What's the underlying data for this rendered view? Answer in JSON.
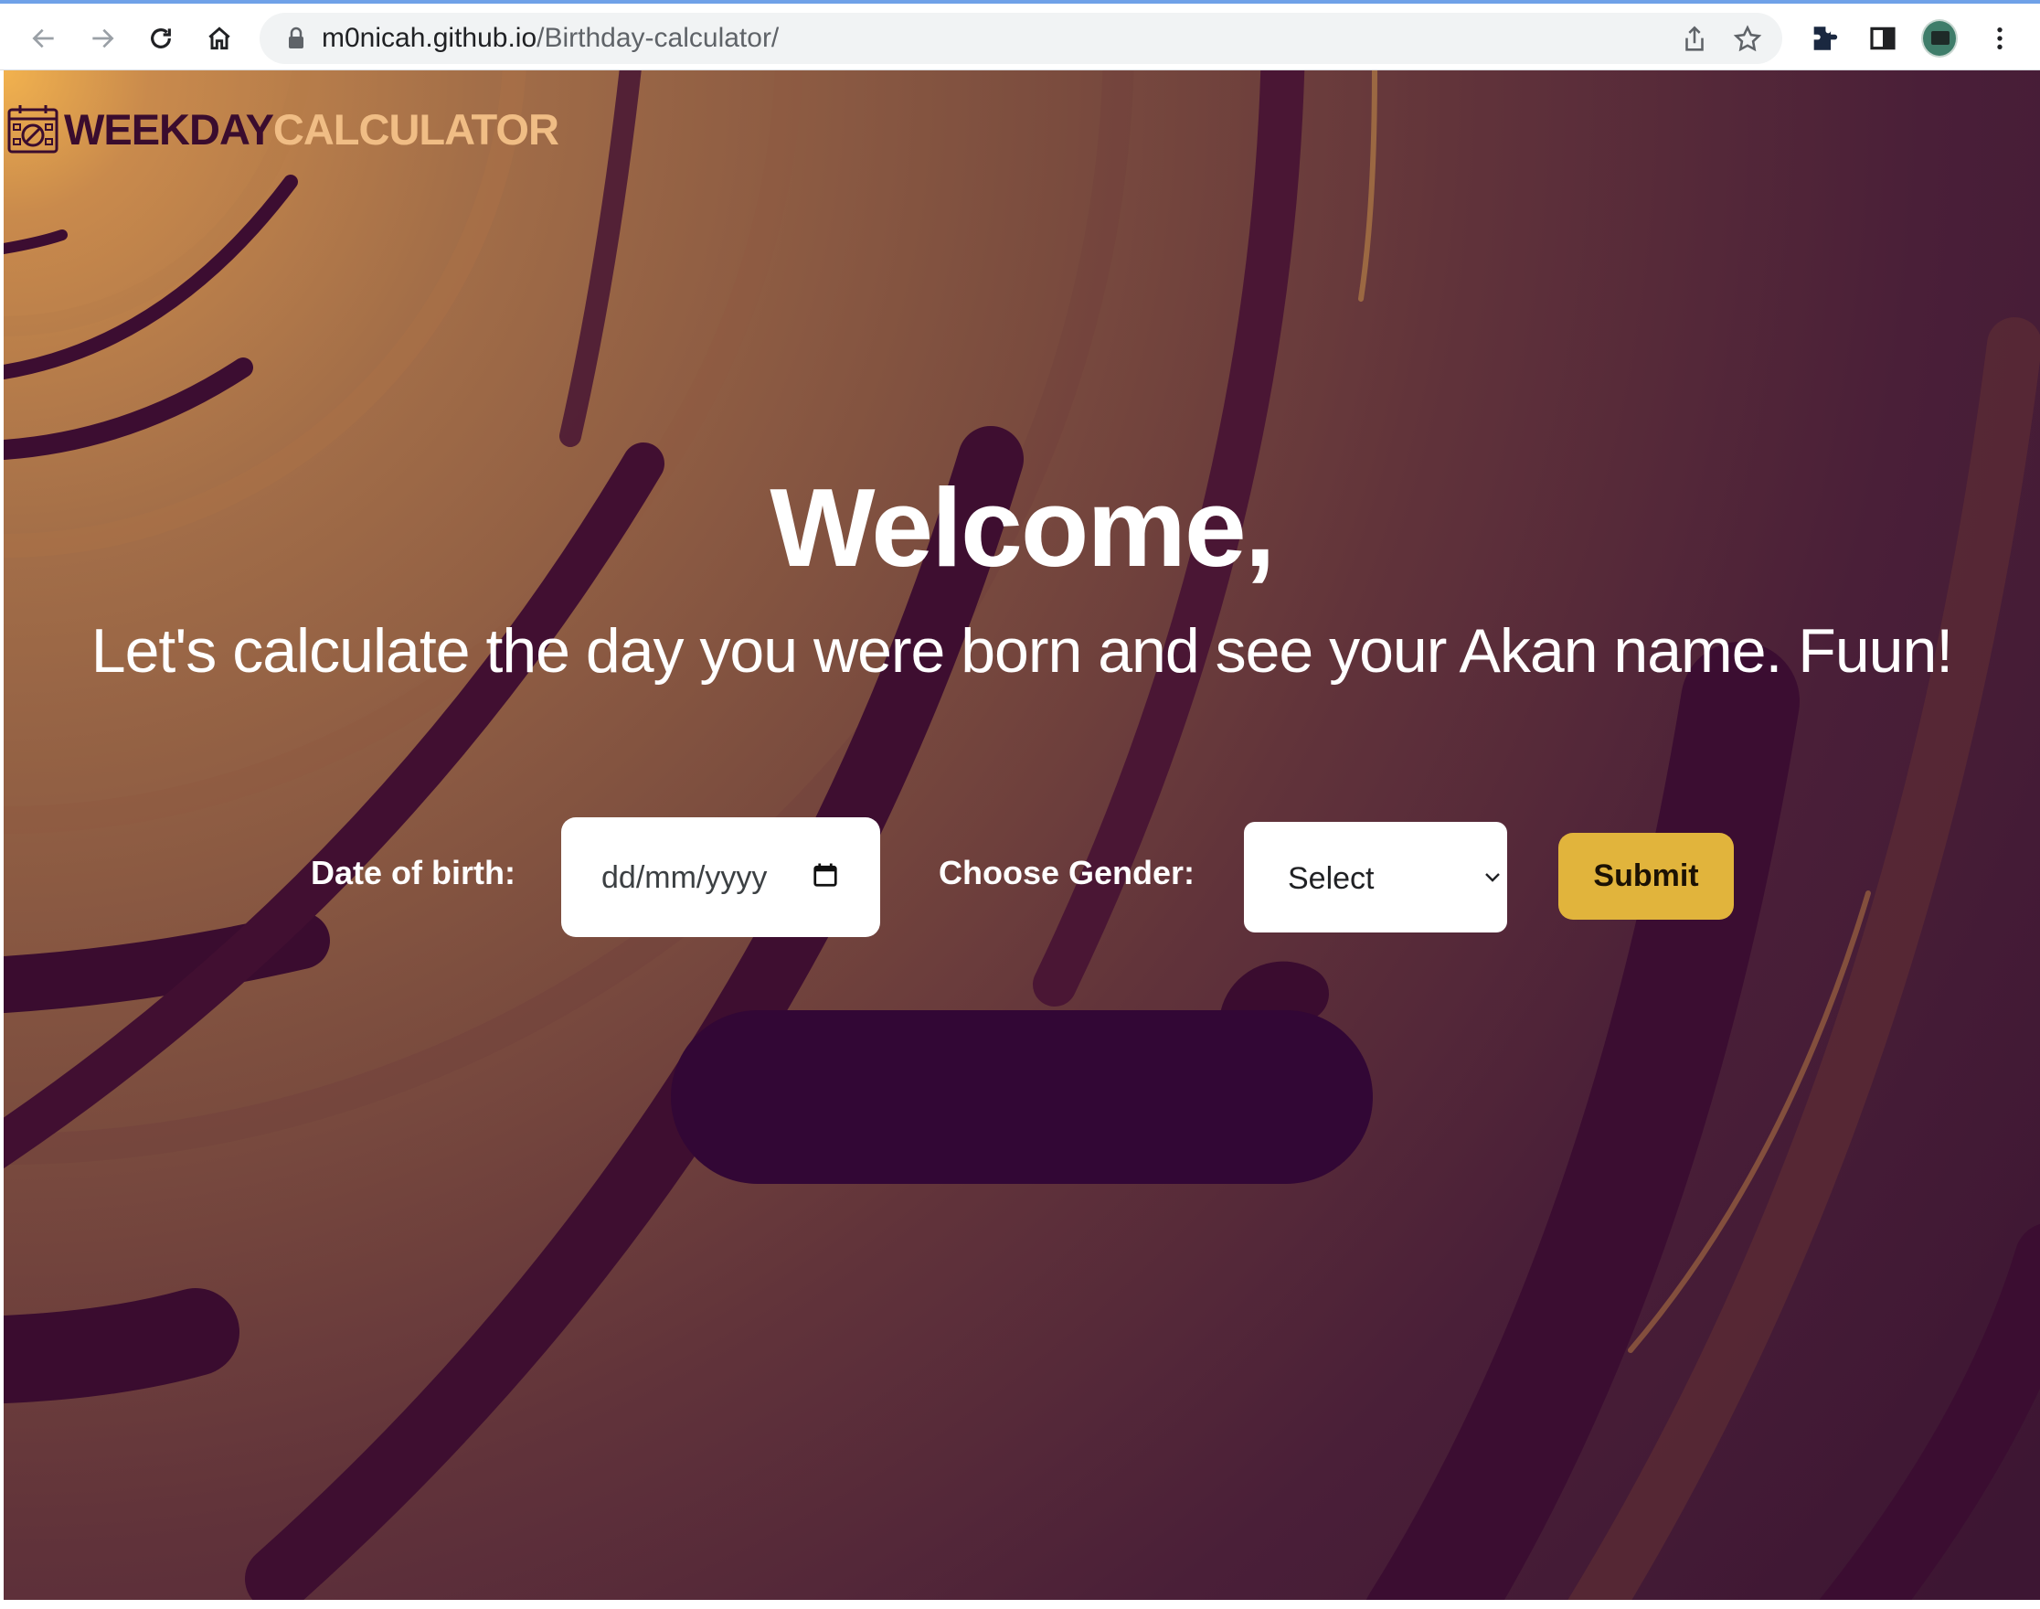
{
  "browser": {
    "url_host": "m0nicah.github.io",
    "url_path": "/Birthday-calculator/",
    "icons": [
      "back-icon",
      "forward-icon",
      "reload-icon",
      "home-icon",
      "lock-icon",
      "share-icon",
      "bookmark-star-icon",
      "extensions-icon",
      "side-panel-icon",
      "profile-avatar",
      "more-menu-icon"
    ]
  },
  "logo": {
    "part1": "WEEKDAY",
    "part2": "CALCULATOR",
    "icon": "calendar-icon"
  },
  "hero": {
    "title": "Welcome,",
    "subtitle": "Let's calculate the day you were born and see your Akan name. Fuun!"
  },
  "form": {
    "dob_label": "Date of birth:",
    "dob_placeholder": "dd/mm/yyyy",
    "gender_label": "Choose Gender:",
    "gender_selected": "Select",
    "submit_label": "Submit"
  },
  "colors": {
    "accent": "#e1b43c",
    "dark_plum": "#320735",
    "logo_light": "#f0bd85"
  }
}
